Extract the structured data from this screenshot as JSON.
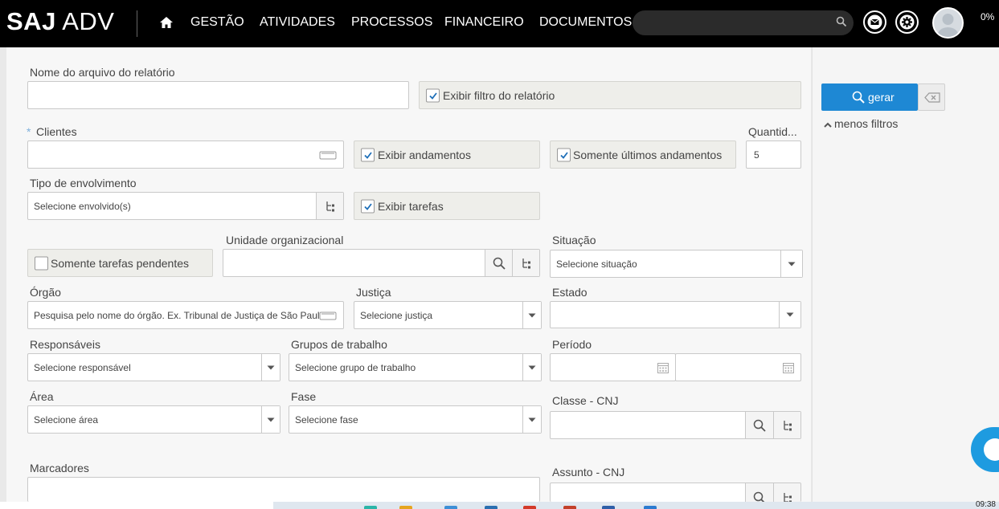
{
  "brand": {
    "logo_bold": "SAJ",
    "logo_light": "ADV"
  },
  "nav": {
    "home_icon": "home-icon",
    "items": [
      "GESTÃO",
      "ATIVIDADES",
      "PROCESSOS",
      "FINANCEIRO",
      "DOCUMENTOS"
    ]
  },
  "header": {
    "search_placeholder": "",
    "progress": "0%",
    "mail_icon": "mail-icon",
    "settings_icon": "gear-icon"
  },
  "form": {
    "nome_arquivo_label": "Nome do arquivo do relatório",
    "nome_arquivo_value": "",
    "exibir_filtro_label": "Exibir filtro do relatório",
    "exibir_filtro_checked": true,
    "clientes_label": "Clientes",
    "clientes_required_mark": "*",
    "exibir_andamentos_label": "Exibir andamentos",
    "exibir_andamentos_checked": true,
    "somente_ultimos_label": "Somente últimos andamentos",
    "somente_ultimos_checked": true,
    "quantidade_label": "Quantid...",
    "quantidade_value": "5",
    "tipo_envolvimento_label": "Tipo de envolvimento",
    "tipo_envolvimento_placeholder": "Selecione envolvido(s)",
    "exibir_tarefas_label": "Exibir tarefas",
    "exibir_tarefas_checked": true,
    "somente_pendentes_label": "Somente tarefas pendentes",
    "somente_pendentes_checked": false,
    "unidade_label": "Unidade organizacional",
    "situacao_label": "Situação",
    "situacao_placeholder": "Selecione situação",
    "orgao_label": "Órgão",
    "orgao_placeholder": "Pesquisa pelo nome do órgão. Ex. Tribunal de Justiça de São Paul",
    "justica_label": "Justiça",
    "justica_placeholder": "Selecione justiça",
    "estado_label": "Estado",
    "estado_placeholder": "",
    "responsaveis_label": "Responsáveis",
    "responsaveis_placeholder": "Selecione responsável",
    "grupos_label": "Grupos de trabalho",
    "grupos_placeholder": "Selecione grupo de trabalho",
    "periodo_label": "Período",
    "area_label": "Área",
    "area_placeholder": "Selecione área",
    "fase_label": "Fase",
    "fase_placeholder": "Selecione fase",
    "classe_label": "Classe - CNJ",
    "marcadores_label": "Marcadores",
    "assunto_label": "Assunto - CNJ"
  },
  "actions": {
    "gerar_label": "gerar",
    "menos_filtros_label": "menos filtros"
  },
  "taskbar": {
    "time": "09:38"
  },
  "colors": {
    "topbar": "#000000",
    "primary_button": "#1e88d4",
    "panel": "#f7f7f7",
    "chat": "#1e9be0"
  }
}
